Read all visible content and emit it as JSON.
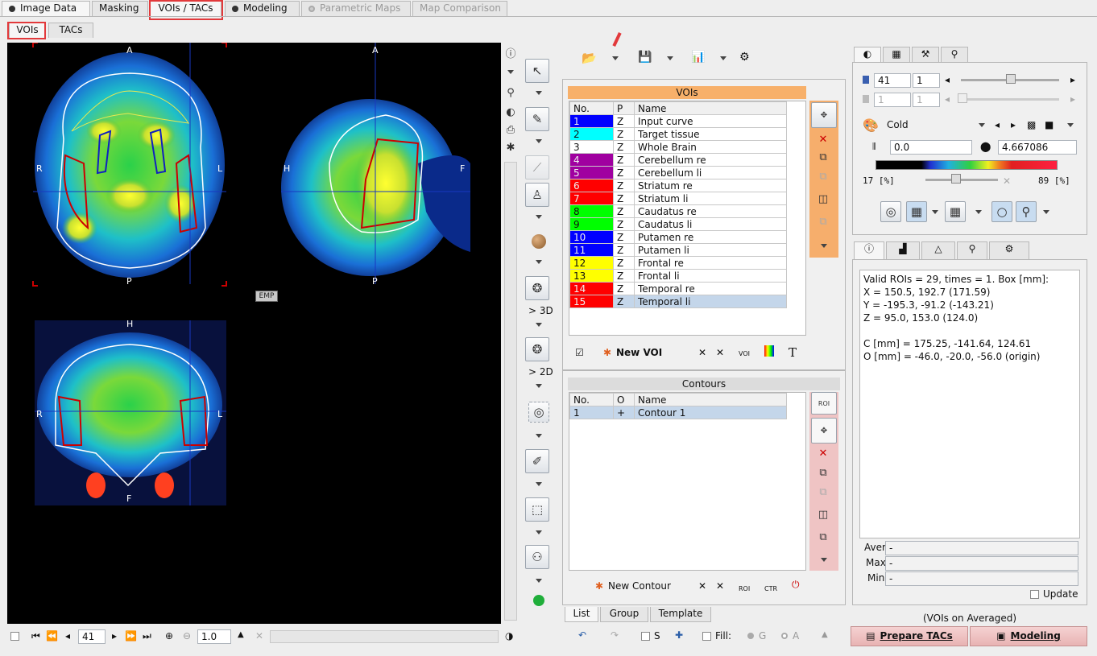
{
  "main_tabs": [
    {
      "label": "Image Data",
      "radio": true
    },
    {
      "label": "Masking",
      "radio": false
    },
    {
      "label": "VOIs / TACs",
      "radio": false
    },
    {
      "label": "Modeling",
      "radio": true
    },
    {
      "label": "Parametric Maps",
      "radio": true
    },
    {
      "label": "Map Comparison",
      "radio": false
    }
  ],
  "sub_tabs": [
    "VOIs",
    "TACs"
  ],
  "viewer": {
    "axial": {
      "top": "A",
      "bottom": "P",
      "left": "R",
      "right": "L"
    },
    "sagittal": {
      "top": "A",
      "bottom": "P",
      "left": "H",
      "right": "F"
    },
    "coronal": {
      "top": "H",
      "bottom": "F",
      "left": "R",
      "right": "L"
    },
    "emp_badge": "EMP",
    "left_tools": {
      "3d_label": "> 3D",
      "2d_label": "> 2D"
    }
  },
  "bottom_toolbar": {
    "slice": "41",
    "zoom": "1.0"
  },
  "vois": {
    "title": "VOIs",
    "columns": [
      "No.",
      "P",
      "Name"
    ],
    "rows": [
      {
        "no": "1",
        "p": "Z",
        "name": "Input curve",
        "color": "#0000ff"
      },
      {
        "no": "2",
        "p": "Z",
        "name": "Target tissue",
        "color": "#00ffff"
      },
      {
        "no": "3",
        "p": "Z",
        "name": "Whole Brain",
        "color": "#ffffff"
      },
      {
        "no": "4",
        "p": "Z",
        "name": "Cerebellum re",
        "color": "#a000a0"
      },
      {
        "no": "5",
        "p": "Z",
        "name": "Cerebellum li",
        "color": "#a000a0"
      },
      {
        "no": "6",
        "p": "Z",
        "name": "Striatum re",
        "color": "#ff0000"
      },
      {
        "no": "7",
        "p": "Z",
        "name": "Striatum li",
        "color": "#ff0000"
      },
      {
        "no": "8",
        "p": "Z",
        "name": "Caudatus re",
        "color": "#00ff00"
      },
      {
        "no": "9",
        "p": "Z",
        "name": "Caudatus li",
        "color": "#00ff00"
      },
      {
        "no": "10",
        "p": "Z",
        "name": "Putamen re",
        "color": "#0000ff"
      },
      {
        "no": "11",
        "p": "Z",
        "name": "Putamen li",
        "color": "#0000ff"
      },
      {
        "no": "12",
        "p": "Z",
        "name": "Frontal re",
        "color": "#ffff00"
      },
      {
        "no": "13",
        "p": "Z",
        "name": "Frontal li",
        "color": "#ffff00"
      },
      {
        "no": "14",
        "p": "Z",
        "name": "Temporal re",
        "color": "#ff0000"
      },
      {
        "no": "15",
        "p": "Z",
        "name": "Temporal li",
        "color": "#ff0000"
      }
    ],
    "new_voi_label": "New VOI"
  },
  "contours": {
    "title": "Contours",
    "columns": [
      "No.",
      "O",
      "Name"
    ],
    "rows": [
      {
        "no": "1",
        "o": "+",
        "name": "Contour 1"
      }
    ],
    "new_contour_label": "New Contour"
  },
  "icon_labels": {
    "voi": "VOI",
    "roi": "ROI",
    "ctr": "CTR"
  },
  "list_tabs": [
    "List",
    "Group",
    "Template"
  ],
  "mid_bottom": {
    "s_label": "S",
    "fill_label": "Fill:",
    "g_label": "G",
    "a_label": "A"
  },
  "color_panel": {
    "frame": "41",
    "frame2": "1",
    "frame3": "1",
    "frame4": "1",
    "lut": "Cold",
    "min": "0.0",
    "max": "4.667086",
    "lower_pct": "17",
    "upper_pct": "89",
    "pct_unit": "[%]"
  },
  "info": {
    "lines": [
      "Valid ROIs = 29, times = 1.  Box [mm]:",
      "X = 150.5, 192.7 (171.59)",
      "Y = -195.3, -91.2 (-143.21)",
      "Z = 95.0, 153.0 (124.0)",
      "",
      "C [mm] = 175.25, -141.64, 124.61",
      "O [mm] = -46.0, -20.0, -56.0 (origin)"
    ],
    "aver_label": "Aver",
    "aver_value": "-",
    "max_label": "Max",
    "max_value": "-",
    "min_label": "Min",
    "min_value": "-",
    "update_label": "Update"
  },
  "footer": {
    "vois_on": "(VOIs on Averaged)",
    "prepare_tacs": "Prepare TACs",
    "modeling": "Modeling"
  }
}
